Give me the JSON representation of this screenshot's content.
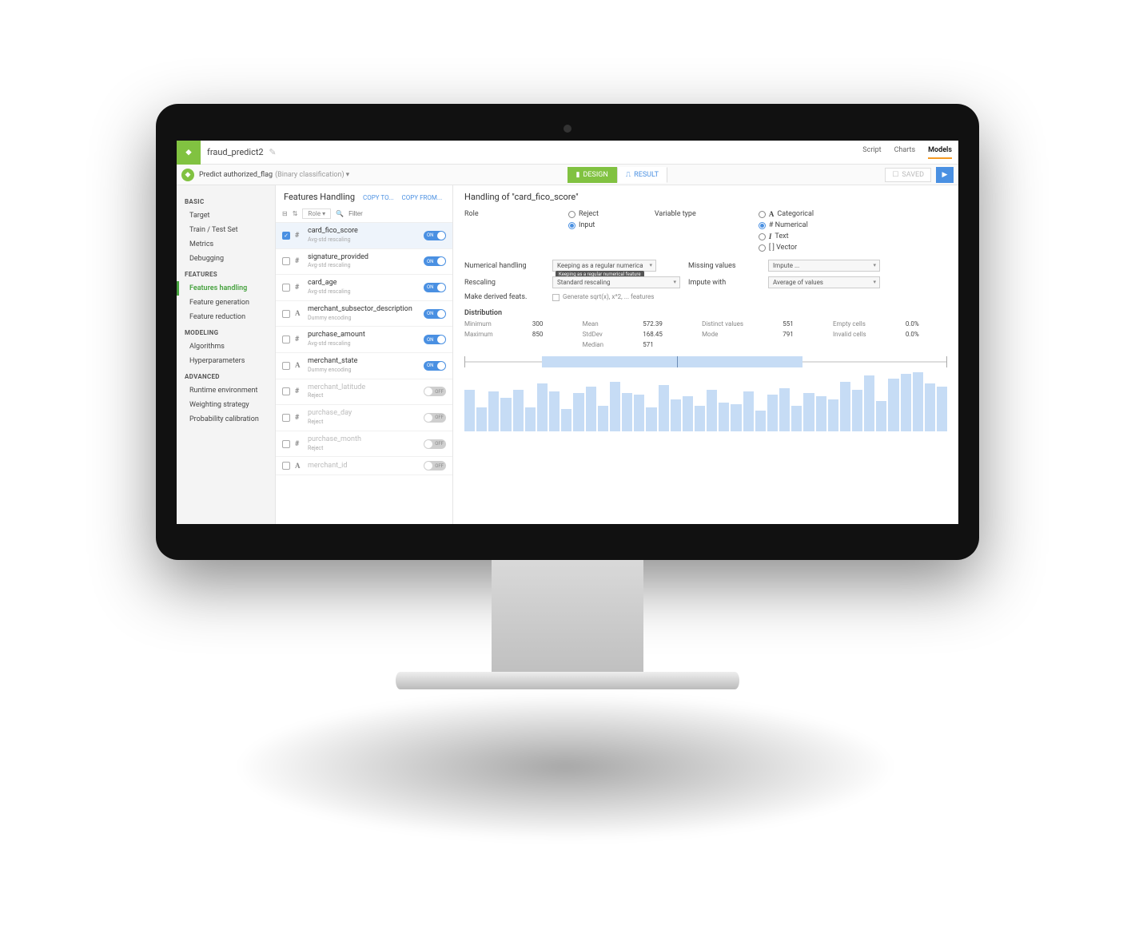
{
  "header": {
    "project": "fraud_predict2",
    "tabs": {
      "script": "Script",
      "charts": "Charts",
      "models": "Models"
    }
  },
  "subbar": {
    "title": "Predict authorized_flag",
    "subtitle": "(Binary classification)",
    "design": "DESIGN",
    "result": "RESULT",
    "saved": "SAVED"
  },
  "sidebar": {
    "basic": "BASIC",
    "basic_items": [
      "Target",
      "Train / Test Set",
      "Metrics",
      "Debugging"
    ],
    "features": "FEATURES",
    "features_items": [
      "Features handling",
      "Feature generation",
      "Feature reduction"
    ],
    "modeling": "MODELING",
    "modeling_items": [
      "Algorithms",
      "Hyperparameters"
    ],
    "advanced": "ADVANCED",
    "advanced_items": [
      "Runtime environment",
      "Weighting strategy",
      "Probability calibration"
    ]
  },
  "listhead": {
    "title": "Features Handling",
    "copyto": "COPY TO...",
    "copyfrom": "COPY FROM..."
  },
  "listctrl": {
    "role": "Role",
    "filter_placeholder": "Filter"
  },
  "features_list": [
    {
      "name": "card_fico_score",
      "sub": "Avg-std rescaling",
      "type": "#",
      "on": true,
      "checked": true,
      "disabled": false
    },
    {
      "name": "signature_provided",
      "sub": "Avg-std rescaling",
      "type": "#",
      "on": true,
      "checked": false,
      "disabled": false
    },
    {
      "name": "card_age",
      "sub": "Avg-std rescaling",
      "type": "#",
      "on": true,
      "checked": false,
      "disabled": false
    },
    {
      "name": "merchant_subsector_description",
      "sub": "Dummy encoding",
      "type": "A",
      "on": true,
      "checked": false,
      "disabled": false
    },
    {
      "name": "purchase_amount",
      "sub": "Avg-std rescaling",
      "type": "#",
      "on": true,
      "checked": false,
      "disabled": false
    },
    {
      "name": "merchant_state",
      "sub": "Dummy encoding",
      "type": "A",
      "on": true,
      "checked": false,
      "disabled": false
    },
    {
      "name": "merchant_latitude",
      "sub": "Reject",
      "type": "#",
      "on": false,
      "checked": false,
      "disabled": true
    },
    {
      "name": "purchase_day",
      "sub": "Reject",
      "type": "#",
      "on": false,
      "checked": false,
      "disabled": true
    },
    {
      "name": "purchase_month",
      "sub": "Reject",
      "type": "#",
      "on": false,
      "checked": false,
      "disabled": true
    },
    {
      "name": "merchant_id",
      "sub": "",
      "type": "A",
      "on": false,
      "checked": false,
      "disabled": true
    }
  ],
  "detail": {
    "title": "Handling of \"card_fico_score\"",
    "role_label": "Role",
    "role_reject": "Reject",
    "role_input": "Input",
    "vt_label": "Variable type",
    "vt_cat": "Categorical",
    "vt_num": "# Numerical",
    "vt_text": "Text",
    "vt_vec": "[ ] Vector",
    "cat_prefix": "A",
    "text_prefix": "I",
    "numh_label": "Numerical handling",
    "numh_value": "Keeping as a regular numerica",
    "numh_tooltip": "Keeping as a regular numerical feature",
    "missing_label": "Missing values",
    "missing_value": "Impute ...",
    "rescaling_label": "Rescaling",
    "rescaling_value": "Standard rescaling",
    "impute_label": "Impute with",
    "impute_value": "Average of values",
    "derived_label": "Make derived feats.",
    "derived_check": "Generate sqrt(x), x^2, ... features",
    "dist_label": "Distribution",
    "stats": {
      "min_k": "Minimum",
      "min_v": "300",
      "max_k": "Maximum",
      "max_v": "850",
      "mean_k": "Mean",
      "mean_v": "572.39",
      "std_k": "StdDev",
      "std_v": "168.45",
      "med_k": "Median",
      "med_v": "571",
      "distinct_k": "Distinct values",
      "distinct_v": "551",
      "mode_k": "Mode",
      "mode_v": "791",
      "empty_k": "Empty cells",
      "empty_v": "0.0%",
      "invalid_k": "Invalid cells",
      "invalid_v": "0.0%"
    }
  },
  "toggle_labels": {
    "on": "ON",
    "off": "OFF"
  },
  "chart_data": {
    "type": "bar",
    "title": "Distribution",
    "xlabel": "",
    "ylabel": "",
    "values": [
      52,
      30,
      50,
      42,
      52,
      30,
      60,
      50,
      28,
      48,
      56,
      32,
      62,
      48,
      46,
      30,
      58,
      40,
      44,
      32,
      52,
      36,
      34,
      50,
      26,
      46,
      54,
      32,
      48,
      44,
      40,
      62,
      52,
      70,
      38,
      66,
      72,
      74,
      60,
      56
    ],
    "boxplot": {
      "min": 300,
      "q1": 420,
      "median": 571,
      "q3": 730,
      "max": 850
    }
  }
}
